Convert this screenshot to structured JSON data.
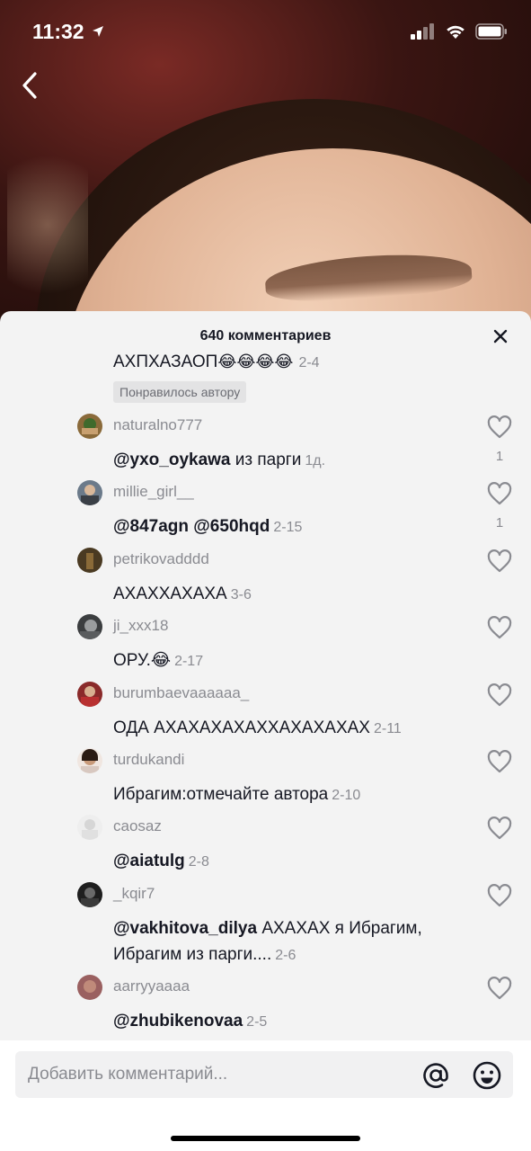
{
  "status": {
    "time": "11:32"
  },
  "sheet": {
    "title": "640 комментариев"
  },
  "partial_comment": {
    "text": "АХПХАЗАОП",
    "emoji": "😂😂😂😂",
    "date": "2-4",
    "liked_by_author": "Понравилось автору"
  },
  "comments": [
    {
      "username": "naturalno777",
      "mention": "@yxo_oykawa",
      "text": " из парги",
      "date": "1д.",
      "likes": "1",
      "avatar_color": "#8a6a3a"
    },
    {
      "username": "millie_girl__",
      "mention": "@847agn @650hqd",
      "text": "",
      "date": "2-15",
      "likes": "1",
      "avatar_color": "#6b7a8a"
    },
    {
      "username": "petrikovadddd",
      "mention": "",
      "text": "АХАХХАХАХА",
      "date": "3-6",
      "likes": "",
      "avatar_color": "#4a3a22"
    },
    {
      "username": "ji_xxx18",
      "mention": "",
      "text": "ОРУ.😂",
      "date": "2-17",
      "likes": "",
      "avatar_color": "#3b3d3f"
    },
    {
      "username": "burumbaevaaaaaa_",
      "mention": "",
      "text": "ОДА АХАХАХАХАХХАХАХАХАХ",
      "date": "2-11",
      "likes": "",
      "avatar_color": "#8a2a2a"
    },
    {
      "username": "turdukandi",
      "mention": "",
      "text": "Ибрагим:отмечайте автора",
      "date": "2-10",
      "likes": "",
      "avatar_color": "#c89a7a"
    },
    {
      "username": "caosaz",
      "mention": "@aiatulg",
      "text": "",
      "date": "2-8",
      "likes": "",
      "avatar_color": "#e6e6e6"
    },
    {
      "username": "_kqir7",
      "mention": "@vakhitova_dilya",
      "text": " АХАХАХ я Ибрагим, Ибрагим из парги....",
      "date": "2-6",
      "likes": "",
      "avatar_color": "#1e1e1e"
    },
    {
      "username": "aarryyaaaa",
      "mention": "@zhubikenovaa",
      "text": "",
      "date": "2-5",
      "likes": "",
      "avatar_color": "#9a6060"
    }
  ],
  "input": {
    "placeholder": "Добавить комментарий..."
  },
  "icons": {
    "back": "chevron-left-icon",
    "close": "close-icon",
    "heart": "heart-outline-icon",
    "mention": "at-sign-icon",
    "emoji": "smiley-icon"
  }
}
